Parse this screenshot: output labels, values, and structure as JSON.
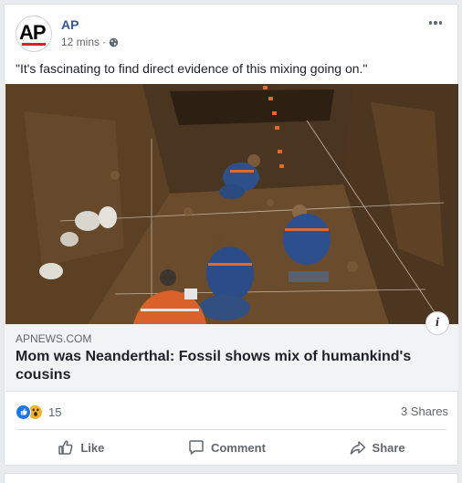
{
  "post": {
    "page_name": "AP",
    "avatar_text": "AP",
    "timestamp": "12 mins",
    "separator": "·",
    "text": "\"It's fascinating to find direct evidence of this mixing going on.\""
  },
  "link": {
    "domain": "APNEWS.COM",
    "headline": "Mom was Neanderthal: Fossil shows mix of humankind's cousins",
    "info_label": "i"
  },
  "stats": {
    "reaction_count": "15",
    "shares": "3 Shares"
  },
  "actions": {
    "like": "Like",
    "comment": "Comment",
    "share": "Share"
  },
  "icons": {
    "more": "more-horizontal-icon",
    "privacy": "globe-icon",
    "like": "thumbs-up-icon",
    "comment": "comment-bubble-icon",
    "share": "share-arrow-icon"
  },
  "colors": {
    "brand_link": "#385898",
    "ap_red": "#e31b23",
    "like_blue": "#1877f2",
    "wow_yellow": "#f7b125"
  }
}
